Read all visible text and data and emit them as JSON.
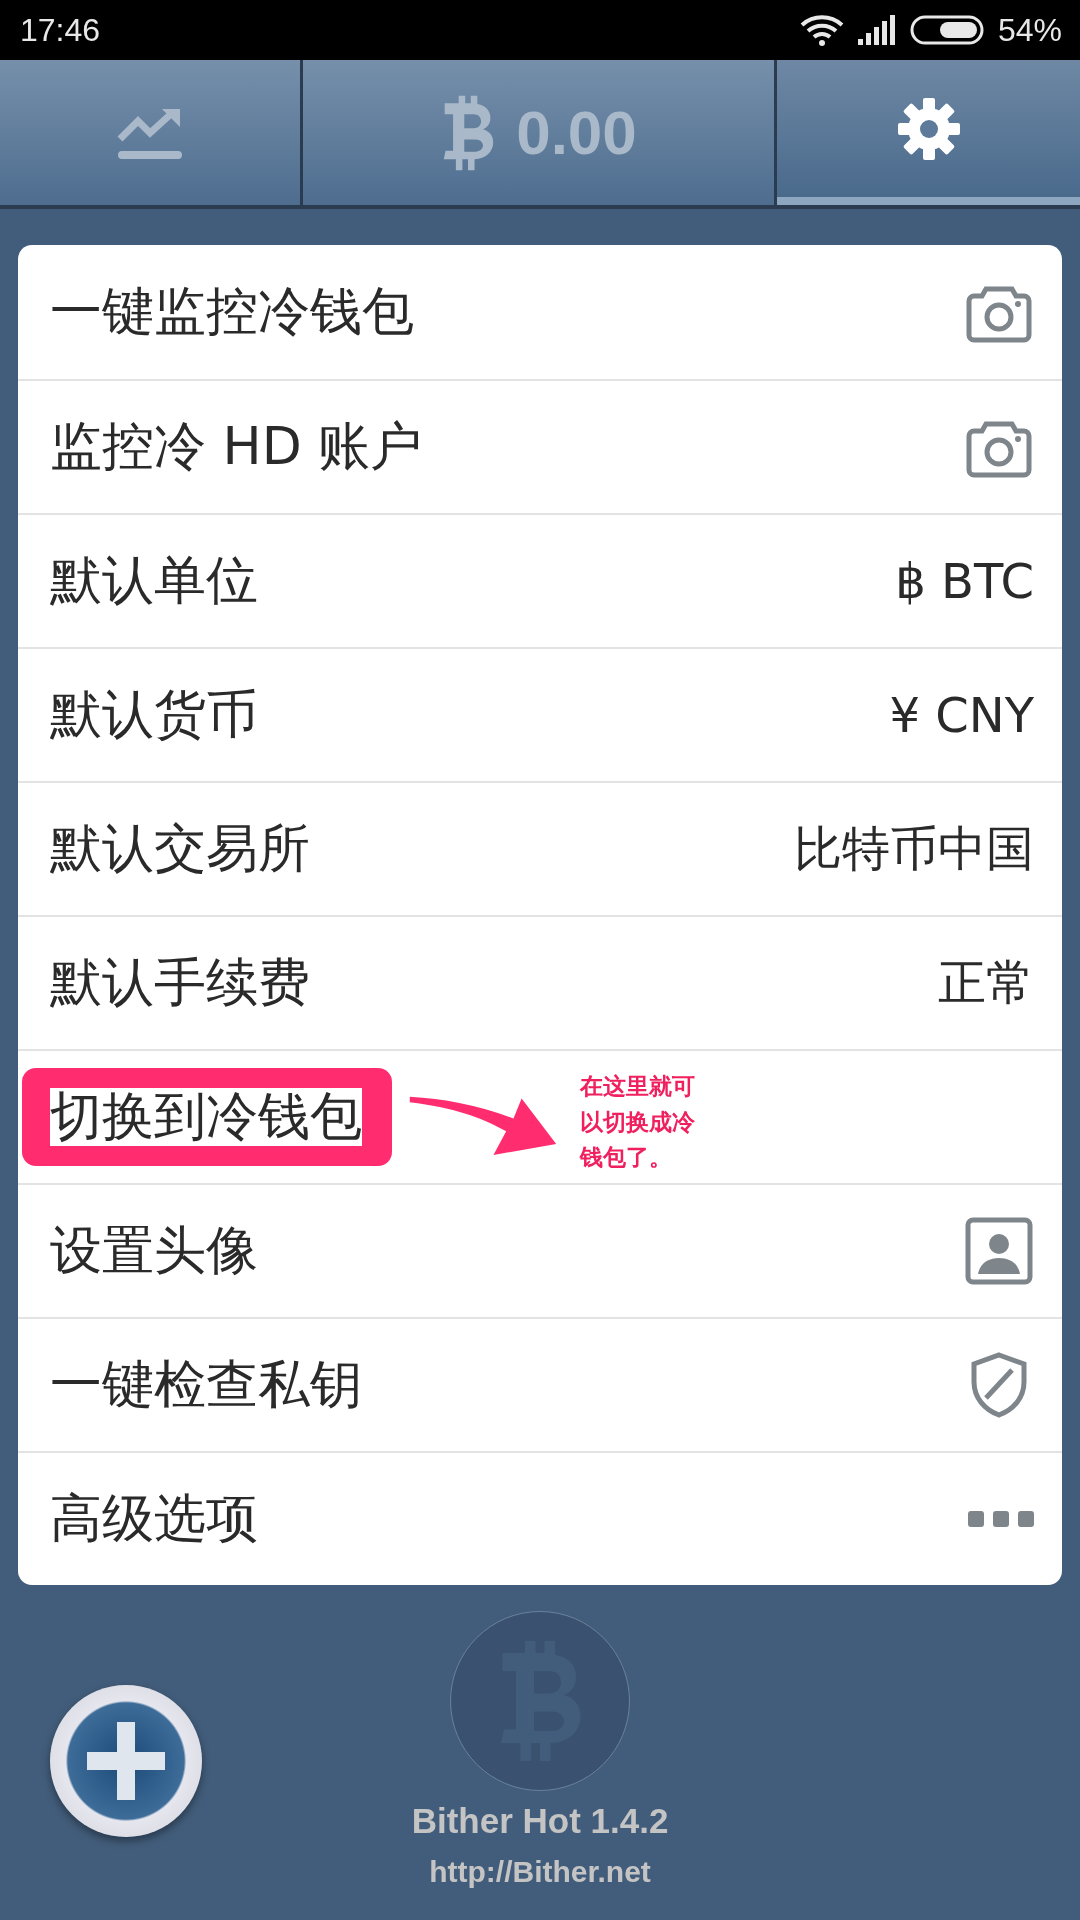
{
  "status_bar": {
    "time": "17:46",
    "battery": "54%"
  },
  "tabs": [
    {
      "kind": "chart",
      "selected": false
    },
    {
      "kind": "balance",
      "label": "0.00",
      "selected": false
    },
    {
      "kind": "settings",
      "selected": true
    }
  ],
  "settings": [
    {
      "label": "一键监控冷钱包",
      "kind": "camera",
      "highlighted": false
    },
    {
      "label": "监控冷 HD 账户",
      "kind": "camera",
      "highlighted": false
    },
    {
      "label": "默认单位",
      "kind": "value",
      "value": "฿ BTC",
      "highlighted": false
    },
    {
      "label": "默认货币",
      "kind": "value",
      "value": "¥ CNY",
      "highlighted": false
    },
    {
      "label": "默认交易所",
      "kind": "value",
      "value": "比特币中国",
      "highlighted": false
    },
    {
      "label": "默认手续费",
      "kind": "value",
      "value": "正常",
      "highlighted": false
    },
    {
      "label": "切换到冷钱包",
      "kind": "none",
      "highlighted": true
    },
    {
      "label": "设置头像",
      "kind": "avatar",
      "highlighted": false
    },
    {
      "label": "一键检查私钥",
      "kind": "shield",
      "highlighted": false
    },
    {
      "label": "高级选项",
      "kind": "more",
      "highlighted": false
    }
  ],
  "annotation": {
    "text": "在这里就可以切换成冷钱包了。"
  },
  "footer": {
    "app_version": "Bither Hot  1.4.2",
    "url": "http://Bither.net"
  }
}
